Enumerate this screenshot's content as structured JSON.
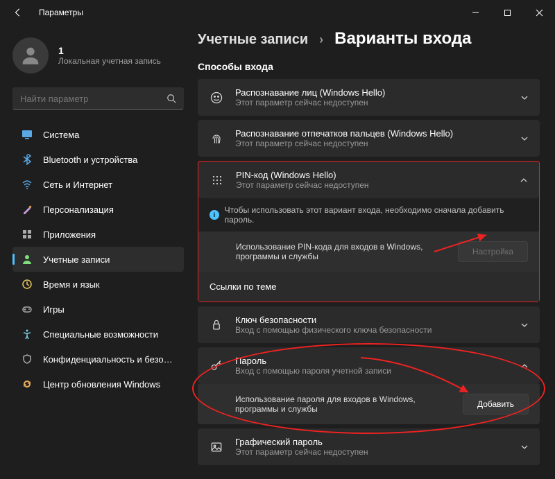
{
  "titlebar": {
    "title": "Параметры"
  },
  "profile": {
    "name": "1",
    "sub": "Локальная учетная запись"
  },
  "search": {
    "placeholder": "Найти параметр"
  },
  "nav": [
    {
      "label": "Система",
      "icon": "system"
    },
    {
      "label": "Bluetooth и устройства",
      "icon": "bluetooth"
    },
    {
      "label": "Сеть и Интернет",
      "icon": "network"
    },
    {
      "label": "Персонализация",
      "icon": "personalization"
    },
    {
      "label": "Приложения",
      "icon": "apps"
    },
    {
      "label": "Учетные записи",
      "icon": "accounts",
      "active": true
    },
    {
      "label": "Время и язык",
      "icon": "time"
    },
    {
      "label": "Игры",
      "icon": "gaming"
    },
    {
      "label": "Специальные возможности",
      "icon": "accessibility"
    },
    {
      "label": "Конфиденциальность и безопасность",
      "icon": "privacy"
    },
    {
      "label": "Центр обновления Windows",
      "icon": "update"
    }
  ],
  "breadcrumb": {
    "lvl1": "Учетные записи",
    "sep": "›",
    "lvl2": "Варианты входа"
  },
  "section": "Способы входа",
  "items": {
    "face": {
      "title": "Распознавание лиц (Windows Hello)",
      "sub": "Этот параметр сейчас недоступен"
    },
    "finger": {
      "title": "Распознавание отпечатков пальцев (Windows Hello)",
      "sub": "Этот параметр сейчас недоступен"
    },
    "pin": {
      "title": "PIN-код (Windows Hello)",
      "sub": "Этот параметр сейчас недоступен",
      "info": "Чтобы использовать этот вариант входа, необходимо сначала добавить пароль.",
      "desc": "Использование PIN-кода для входов в Windows, программы и службы",
      "btn": "Настройка",
      "links": "Ссылки по теме"
    },
    "key": {
      "title": "Ключ безопасности",
      "sub": "Вход с помощью физического ключа безопасности"
    },
    "password": {
      "title": "Пароль",
      "sub": "Вход с помощью пароля учетной записи",
      "desc": "Использование пароля для входов в Windows, программы и службы",
      "btn": "Добавить"
    },
    "picture": {
      "title": "Графический пароль",
      "sub": "Этот параметр сейчас недоступен"
    }
  }
}
